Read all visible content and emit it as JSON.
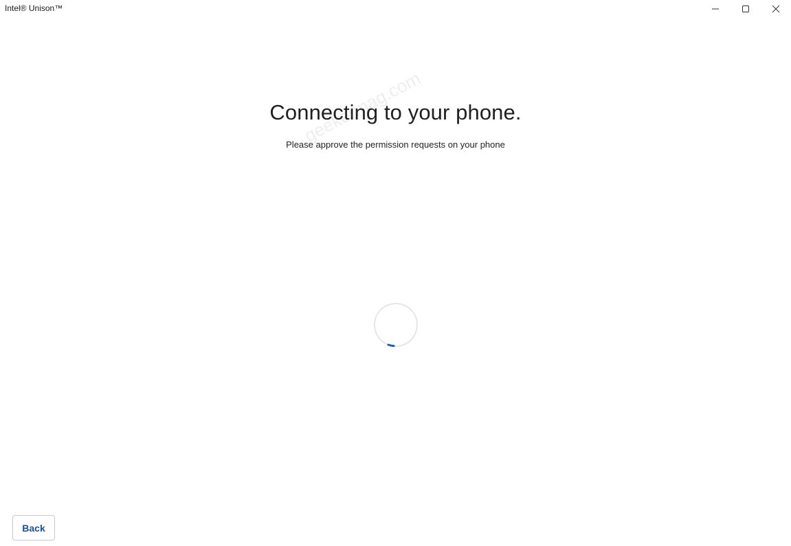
{
  "window": {
    "title": "Intel® Unison™"
  },
  "main": {
    "heading": "Connecting to your phone.",
    "subheading": "Please approve the permission requests on your phone",
    "watermark": "geekermag.com"
  },
  "footer": {
    "back_label": "Back"
  },
  "icons": {
    "minimize": "minimize-icon",
    "maximize": "maximize-icon",
    "close": "close-icon",
    "spinner": "loading-spinner"
  },
  "colors": {
    "accent": "#1d5fa8",
    "back_text": "#1d4f91",
    "spinner_track": "#e6e6e6"
  }
}
